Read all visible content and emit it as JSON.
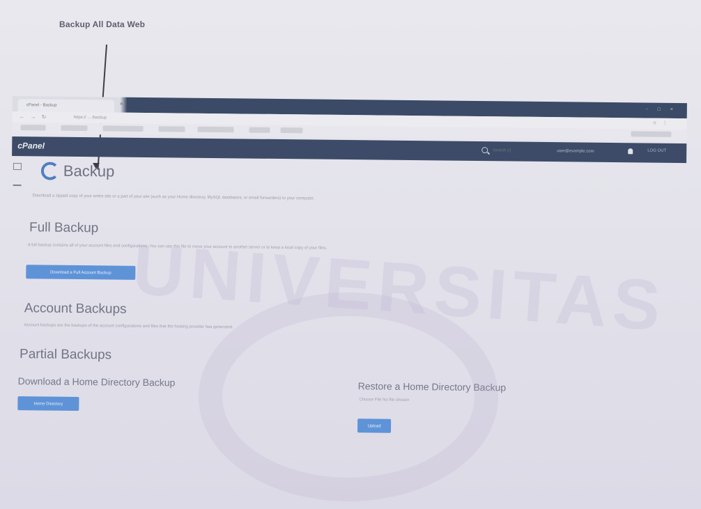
{
  "annotation": {
    "title": "Backup All Data Web"
  },
  "browser": {
    "tab_title": "cPanel - Backup",
    "url_text": "https:// ... /backup",
    "window_controls": "- □ ×"
  },
  "cpanel": {
    "logo_text": "cPanel",
    "search_placeholder": "Search (/)",
    "user_menu_text": "user@example.com",
    "logout_text": "LOG OUT"
  },
  "backup_page": {
    "title": "Backup",
    "intro": "Download a zipped copy of your entire site or a part of your site (such as your Home directory, MySQL databases, or email forwarders) to your computer.",
    "full_backup": {
      "title": "Full Backup",
      "description": "A full backup contains all of your account files and configurations. You can use this file to move your account to another server or to keep a local copy of your files.",
      "button_label": "Download a Full Account Backup"
    },
    "account_backups": {
      "title": "Account Backups",
      "description": "Account backups are the backups of the account configurations and files that the hosting provider has generated."
    },
    "partial_backups": {
      "title": "Partial Backups",
      "download_home_title": "Download a Home Directory Backup",
      "download_home_button": "Home Directory",
      "restore_home_title": "Restore a Home Directory Backup",
      "restore_home_label": "Choose File  No file chosen",
      "upload_button": "Upload"
    }
  },
  "watermark": {
    "text": "UNIVERSITAS"
  }
}
